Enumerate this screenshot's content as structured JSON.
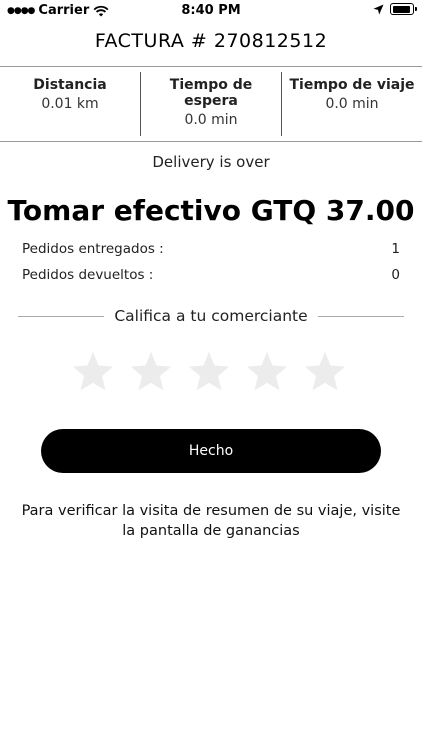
{
  "status_bar": {
    "carrier": "Carrier",
    "time": "8:40 PM"
  },
  "header": {
    "title": "FACTURA # 270812512"
  },
  "stats": [
    {
      "label": "Distancia",
      "value": "0.01 km"
    },
    {
      "label": "Tiempo de espera",
      "value": "0.0 min"
    },
    {
      "label": "Tiempo de viaje",
      "value": "0.0 min"
    }
  ],
  "summary": {
    "status": "Delivery is over",
    "cash_message": "Tomar efectivo GTQ 37.00",
    "delivered_label": "Pedidos entregados :",
    "delivered_value": "1",
    "returned_label": "Pedidos devueltos :",
    "returned_value": "0"
  },
  "rating": {
    "prompt": "Califica a tu comerciante",
    "value": 0,
    "max": 5
  },
  "done_button": {
    "label": "Hecho"
  },
  "footer": {
    "info": "Para verificar la visita de resumen de su viaje, visite la pantalla de ganancias"
  }
}
